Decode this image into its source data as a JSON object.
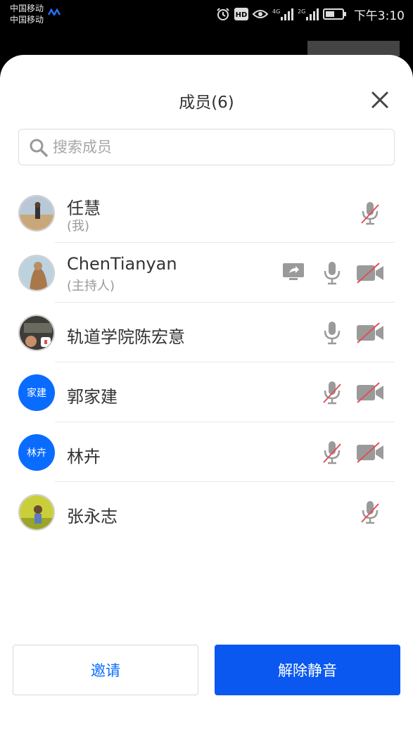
{
  "status_bar": {
    "carrier_1": "中国移动",
    "carrier_2": "中国移动",
    "hd_label": "HD",
    "net_1": "4G",
    "net_2": "2G",
    "time": "下午3:10"
  },
  "panel": {
    "title": "成员(6)",
    "search_placeholder": "搜索成员"
  },
  "members": [
    {
      "name": "任慧",
      "role": "(我)",
      "avatar": "photo",
      "icons": [
        "mic-muted-icon"
      ]
    },
    {
      "name": "ChenTianyan",
      "role": "(主持人)",
      "avatar": "photo",
      "icons": [
        "screen-share-icon",
        "mic-icon",
        "camera-off-icon"
      ]
    },
    {
      "name": "轨道学院陈宏意",
      "role": "",
      "avatar": "photo",
      "icons": [
        "mic-icon",
        "camera-off-icon"
      ]
    },
    {
      "name": "郭家建",
      "role": "",
      "avatar_text": "家建",
      "icons": [
        "mic-muted-icon",
        "camera-off-icon"
      ]
    },
    {
      "name": "林卉",
      "role": "",
      "avatar_text": "林卉",
      "icons": [
        "mic-muted-icon",
        "camera-off-icon"
      ]
    },
    {
      "name": "张永志",
      "role": "",
      "avatar": "photo",
      "icons": [
        "mic-muted-icon"
      ]
    }
  ],
  "buttons": {
    "invite": "邀请",
    "unmute": "解除静音"
  },
  "colors": {
    "accent": "#0a58f0",
    "avatar_blue": "#0a6cff",
    "mute_red": "#e0505a"
  }
}
